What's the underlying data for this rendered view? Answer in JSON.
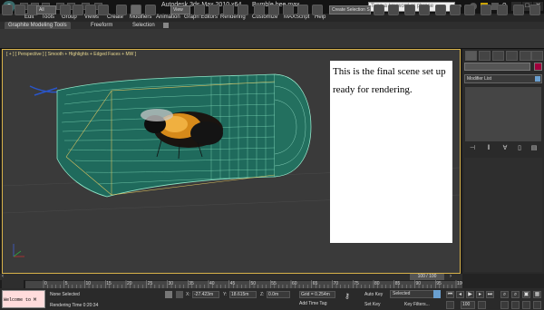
{
  "title_bar": {
    "app_title": "Autodesk 3ds Max  2010 x64",
    "file_name": "Bumble bee.max",
    "search_placeholder": "Type a keyword or phrase",
    "window_buttons": [
      "_",
      "□",
      "✕"
    ]
  },
  "menu": {
    "items": [
      "Edit",
      "Tools",
      "Group",
      "Views",
      "Create",
      "Modifiers",
      "Animation",
      "Graph Editors",
      "Rendering",
      "Customize",
      "MAXScript",
      "Help"
    ]
  },
  "ribbon": {
    "tabs": [
      "Graphite Modeling Tools",
      "Freeform",
      "Selection"
    ]
  },
  "toolbar": {
    "selection_filter": "All",
    "reference_coord": "View",
    "named_selection": "Create Selection Se"
  },
  "viewport": {
    "label": "[ + ] [ Perspective ] [ Smooth + Highlights + Edged Faces + MW ]",
    "note_text": "This is the final scene set up ready for rendering."
  },
  "command_panel": {
    "modifier_list": "Modifier List",
    "object_color": "#a0003c"
  },
  "timeline": {
    "frame_indicator": "100 / 100",
    "ticks": [
      "0",
      "5",
      "10",
      "15",
      "20",
      "25",
      "30",
      "35",
      "40",
      "45",
      "50",
      "55",
      "60",
      "65",
      "70",
      "75",
      "80",
      "85",
      "90",
      "95",
      "100"
    ]
  },
  "status": {
    "listener": "Welcome to M",
    "selection": "None Selected",
    "rendering_time": "Rendering Time  0:20:34",
    "x_label": "X:",
    "x_value": "-27.423m",
    "y_label": "Y:",
    "y_value": "18.615m",
    "z_label": "Z:",
    "z_value": "0.0m",
    "grid": "Grid = 0.254m",
    "add_time_tag": "Add Time Tag",
    "auto_key": "Auto Key",
    "set_key": "Set Key",
    "key_mode": "Selected",
    "key_filters": "Key Filters...",
    "current_frame": "100"
  }
}
